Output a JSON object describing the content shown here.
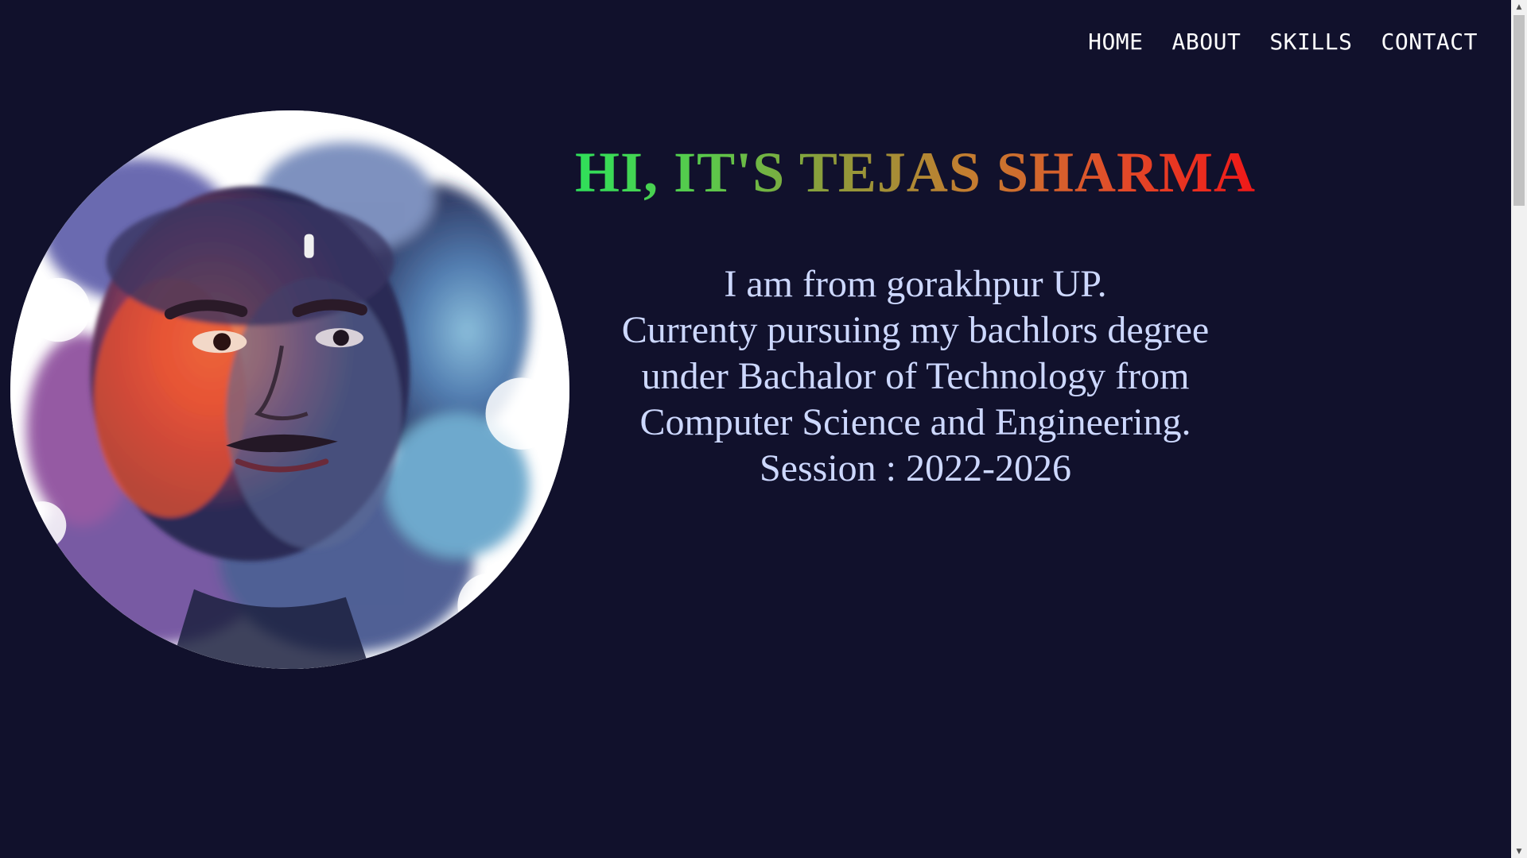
{
  "nav": {
    "items": [
      {
        "label": "HOME"
      },
      {
        "label": "ABOUT"
      },
      {
        "label": "SKILLS"
      },
      {
        "label": "CONTACT"
      }
    ]
  },
  "hero": {
    "title": "HI, IT'S TEJAS SHARMA",
    "description": [
      "I am from gorakhpur UP.",
      "Currenty pursuing my bachlors degree",
      "under Bachalor of Technology from",
      "Computer Science and Engineering.",
      "Session : 2022-2026"
    ]
  },
  "portrait": {
    "icon": "profile-photo"
  },
  "colors": {
    "background": "#11112c",
    "nav_text": "#ffffff",
    "description_text": "#cdd8ff",
    "title_gradient_start": "#2fe05a",
    "title_gradient_end": "#f01818"
  }
}
